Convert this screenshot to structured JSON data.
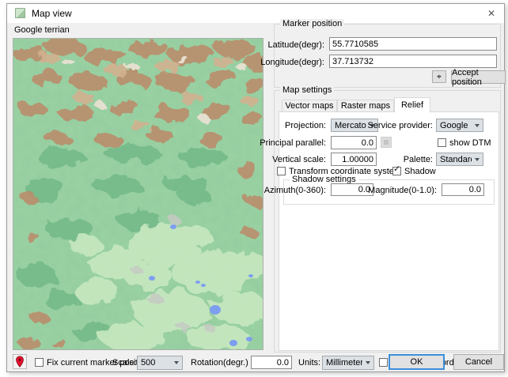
{
  "window": {
    "title": "Map view"
  },
  "icons": {
    "check": "✓",
    "close": "✕",
    "center": "⌖"
  },
  "colors": {
    "accent": "#3d8edb",
    "marker_red": "#e8112d",
    "dialog_bg": "#f0f0f0"
  },
  "map_panel": {
    "label": "Google terrian",
    "palette": {
      "base_green": "#9bd3a4",
      "dark_green": "#68b281",
      "light_green": "#c7e8c0",
      "gray_patch": "#c6cac3",
      "mountain_brown": "#b98f6d",
      "mountain_tan": "#d2b190",
      "peak_white": "#e9e1d3",
      "lake_blue": "#7e9ef0"
    }
  },
  "marker_position": {
    "group_label": "Marker position",
    "latitude_label": "Latitude(degr):",
    "latitude_value": "55.7710585",
    "longitude_label": "Longitude(degr):",
    "longitude_value": "37.713732",
    "accept_button_label": "Accept position"
  },
  "map_settings": {
    "group_label": "Map settings",
    "tabs": [
      {
        "label": "Vector maps"
      },
      {
        "label": "Raster maps"
      },
      {
        "label": "Relief"
      }
    ],
    "projection_label": "Projection:",
    "projection_value": "Mercator",
    "service_provider_label": "Service provider:",
    "service_provider_value": "Google",
    "principal_parallel_label": "Principal parallel:",
    "principal_parallel_value": "0.0",
    "show_dtm_label": "show DTM",
    "vertical_scale_label": "Vertical scale:",
    "vertical_scale_value": "1.00000",
    "palette_label": "Palette:",
    "palette_value": "Standard",
    "transform_label": "Transform coordinate system",
    "shadow_label": "Shadow",
    "shadow_settings": {
      "group_label": "Shadow settings",
      "azimuth_label": "Azimuth(0-360):",
      "azimuth_value": "0.0",
      "magnitude_label": "Magnitude(0-1.0):",
      "magnitude_value": "0.0"
    }
  },
  "bottom_bar": {
    "fix_marker_label": "Fix current marker position",
    "scale_label": "Scale:",
    "scale_value": "500",
    "rotation_label": "Rotation(degr.)",
    "rotation_value": "0.0",
    "units_label": "Units:",
    "units_value": "Millimeters",
    "put_real_label": "Put to real coordinates",
    "ok_label": "OK",
    "cancel_label": "Cancel"
  }
}
